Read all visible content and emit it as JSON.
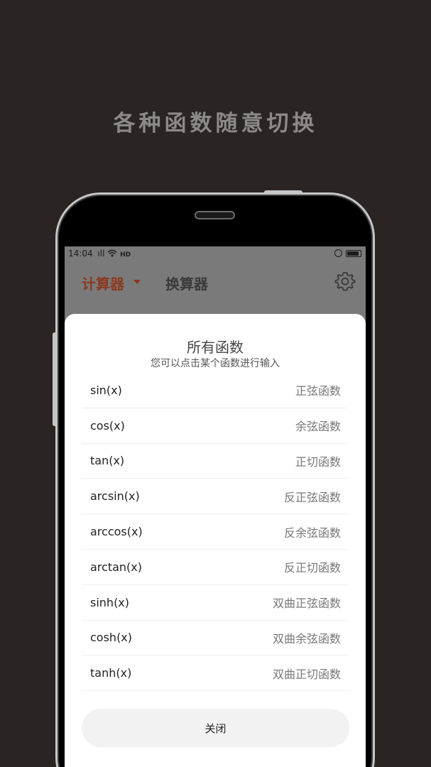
{
  "headline": "各种函数随意切换",
  "status": {
    "time": "14:04",
    "signal": "ıll",
    "network": "HD"
  },
  "appbar": {
    "active_tab": "计算器",
    "inactive_tab": "换算器"
  },
  "sheet": {
    "title": "所有函数",
    "subtitle": "您可以点击某个函数进行输入",
    "functions": [
      {
        "name": "sin(x)",
        "desc": "正弦函数"
      },
      {
        "name": "cos(x)",
        "desc": "余弦函数"
      },
      {
        "name": "tan(x)",
        "desc": "正切函数"
      },
      {
        "name": "arcsin(x)",
        "desc": "反正弦函数"
      },
      {
        "name": "arccos(x)",
        "desc": "反余弦函数"
      },
      {
        "name": "arctan(x)",
        "desc": "反正切函数"
      },
      {
        "name": "sinh(x)",
        "desc": "双曲正弦函数"
      },
      {
        "name": "cosh(x)",
        "desc": "双曲余弦函数"
      },
      {
        "name": "tanh(x)",
        "desc": "双曲正切函数"
      }
    ],
    "close_label": "关闭"
  },
  "colors": {
    "accent": "#8a3a22",
    "background": "#2a2523"
  },
  "icons": [
    "caret-down-icon",
    "gear-icon",
    "wifi-icon",
    "lock-icon",
    "battery-icon"
  ]
}
